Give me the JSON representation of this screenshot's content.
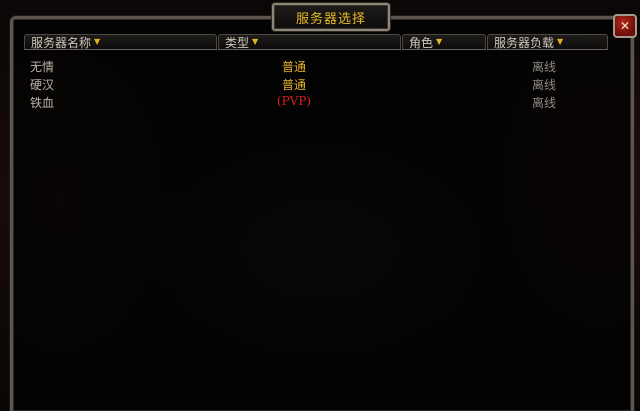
{
  "window": {
    "title": "服务器选择"
  },
  "columns": [
    {
      "label": "服务器名称",
      "sort_icon": "sort-arrow-icon"
    },
    {
      "label": "类型",
      "sort_icon": "sort-arrow-icon"
    },
    {
      "label": "角色",
      "sort_icon": "sort-arrow-icon"
    },
    {
      "label": "服务器负载",
      "sort_icon": "sort-arrow-icon"
    }
  ],
  "servers": [
    {
      "name": "无情",
      "type": "普通",
      "type_color": "#e5b425",
      "characters": "",
      "load": "离线"
    },
    {
      "name": "硬汉",
      "type": "普通",
      "type_color": "#e5b425",
      "characters": "",
      "load": "离线"
    },
    {
      "name": "铁血",
      "type": "(PVP)",
      "type_color": "#d21f1f",
      "characters": "",
      "load": "离线"
    }
  ],
  "close_button": {
    "label": "✕",
    "icon": "close-icon"
  }
}
